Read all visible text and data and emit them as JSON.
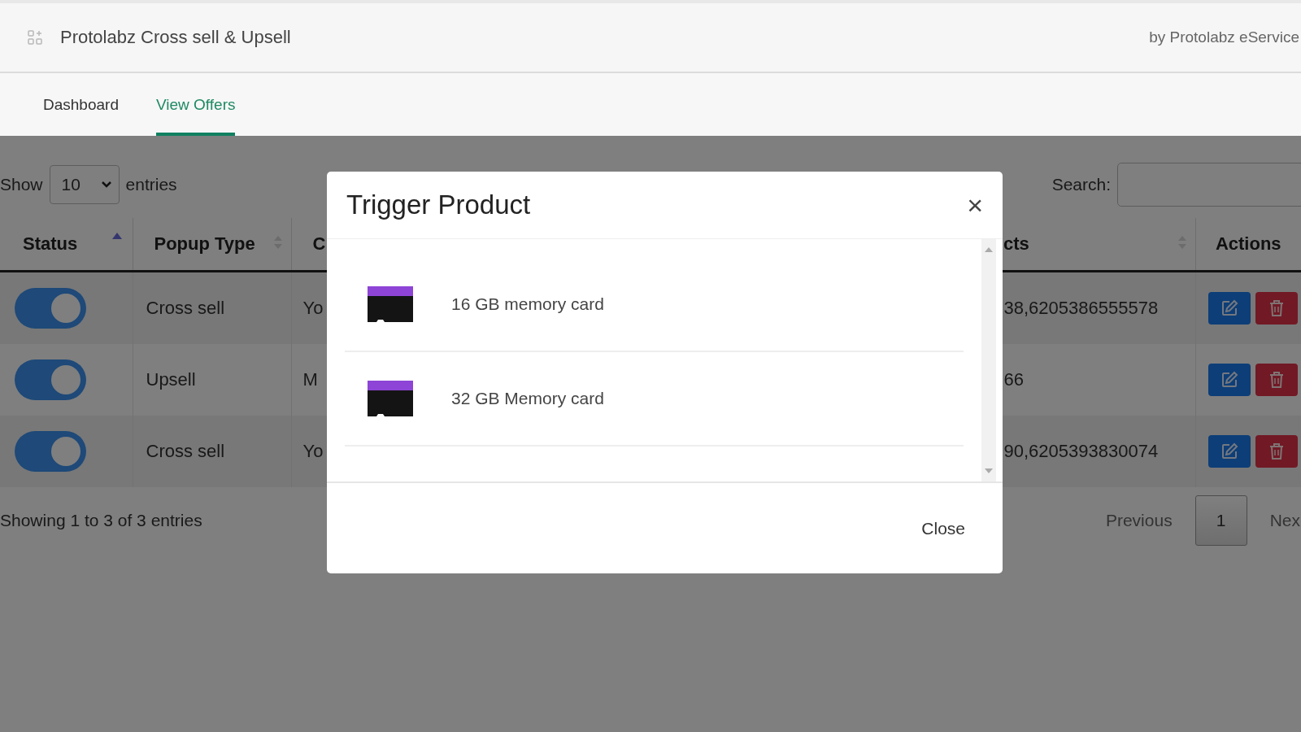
{
  "app": {
    "title": "Protolabz Cross sell & Upsell",
    "vendor": "by Protolabz eService"
  },
  "tabs": [
    {
      "label": "Dashboard",
      "selected": false
    },
    {
      "label": "View Offers",
      "selected": true
    }
  ],
  "length_menu": {
    "prefix": "Show",
    "value": "10",
    "suffix": "entries"
  },
  "search": {
    "label": "Search:"
  },
  "table": {
    "columns": [
      {
        "label": "Status",
        "sorted": true
      },
      {
        "label": "Popup Type",
        "sorted": false
      },
      {
        "label": "C"
      },
      {
        "label": "cts",
        "sorted": false
      },
      {
        "label": "Actions"
      }
    ],
    "rows": [
      {
        "on": true,
        "popup_type": "Cross sell",
        "column_3": "Yo",
        "products": "38,6205386555578"
      },
      {
        "on": true,
        "popup_type": "Upsell",
        "column_3": "M",
        "products": "66"
      },
      {
        "on": true,
        "popup_type": "Cross sell",
        "column_3": "Yo",
        "products": "90,6205393830074"
      }
    ]
  },
  "info": "Showing 1 to 3 of 3 entries",
  "pagination": {
    "previous": "Previous",
    "pages": [
      {
        "label": "1",
        "selected": true
      }
    ],
    "next": "Nex"
  },
  "modal": {
    "title": "Trigger Product",
    "close_symbol": "×",
    "items": [
      {
        "name": "16 GB memory card"
      },
      {
        "name": "32 GB Memory card"
      }
    ],
    "close_button": "Close"
  }
}
